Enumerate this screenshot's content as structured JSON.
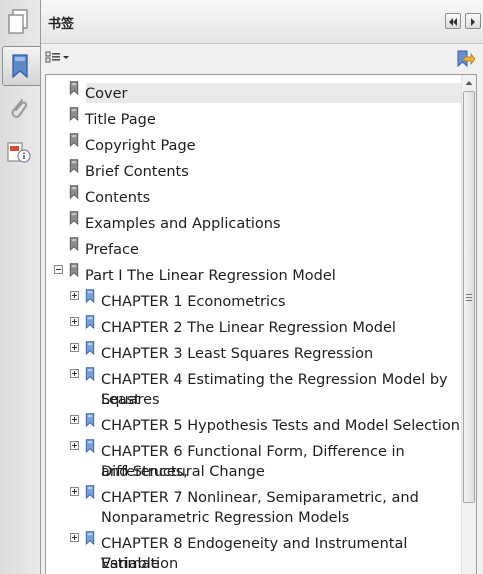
{
  "panel": {
    "title": "书签"
  },
  "bookmarks": [
    {
      "label": "Cover",
      "level": 0
    },
    {
      "label": "Title Page",
      "level": 0
    },
    {
      "label": "Copyright Page",
      "level": 0
    },
    {
      "label": "Brief Contents",
      "level": 0
    },
    {
      "label": "Contents",
      "level": 0
    },
    {
      "label": "Examples and Applications",
      "level": 0
    },
    {
      "label": "Preface",
      "level": 0
    },
    {
      "label": "Part I The Linear Regression Model",
      "level": 0,
      "expander": "collapse"
    },
    {
      "label": "CHAPTER 1 Econometrics",
      "level": 1,
      "expander": "expand"
    },
    {
      "label": "CHAPTER 2 The Linear Regression Model",
      "level": 1,
      "expander": "expand"
    },
    {
      "label": "CHAPTER 3 Least Squares Regression",
      "level": 1,
      "expander": "expand"
    },
    {
      "label_lines": [
        "CHAPTER 4 Estimating the Regression Model by Least",
        "Squares"
      ],
      "level": 1,
      "expander": "expand"
    },
    {
      "label": "CHAPTER 5 Hypothesis Tests and Model Selection",
      "level": 1,
      "expander": "expand"
    },
    {
      "label_lines": [
        "CHAPTER 6 Functional Form, Difference in Differences,",
        "and Structural Change"
      ],
      "level": 1,
      "expander": "expand"
    },
    {
      "label_lines": [
        "CHAPTER 7 Nonlinear, Semiparametric, and",
        "Nonparametric Regression Models"
      ],
      "level": 1,
      "expander": "expand"
    },
    {
      "label_lines": [
        "CHAPTER 8 Endogeneity and Instrumental Variable",
        "Estimation"
      ],
      "level": 1,
      "expander": "expand"
    }
  ],
  "selected_index": 0,
  "icons": {
    "pages": "pages-icon",
    "bookmarks": "bookmark-panel-icon",
    "attachments": "paperclip-icon",
    "security": "document-info-icon",
    "collapse_panel": "double-left-arrow-icon",
    "expand_panel": "right-arrow-icon",
    "options": "options-menu-icon",
    "properties": "bookmark-properties-icon"
  }
}
